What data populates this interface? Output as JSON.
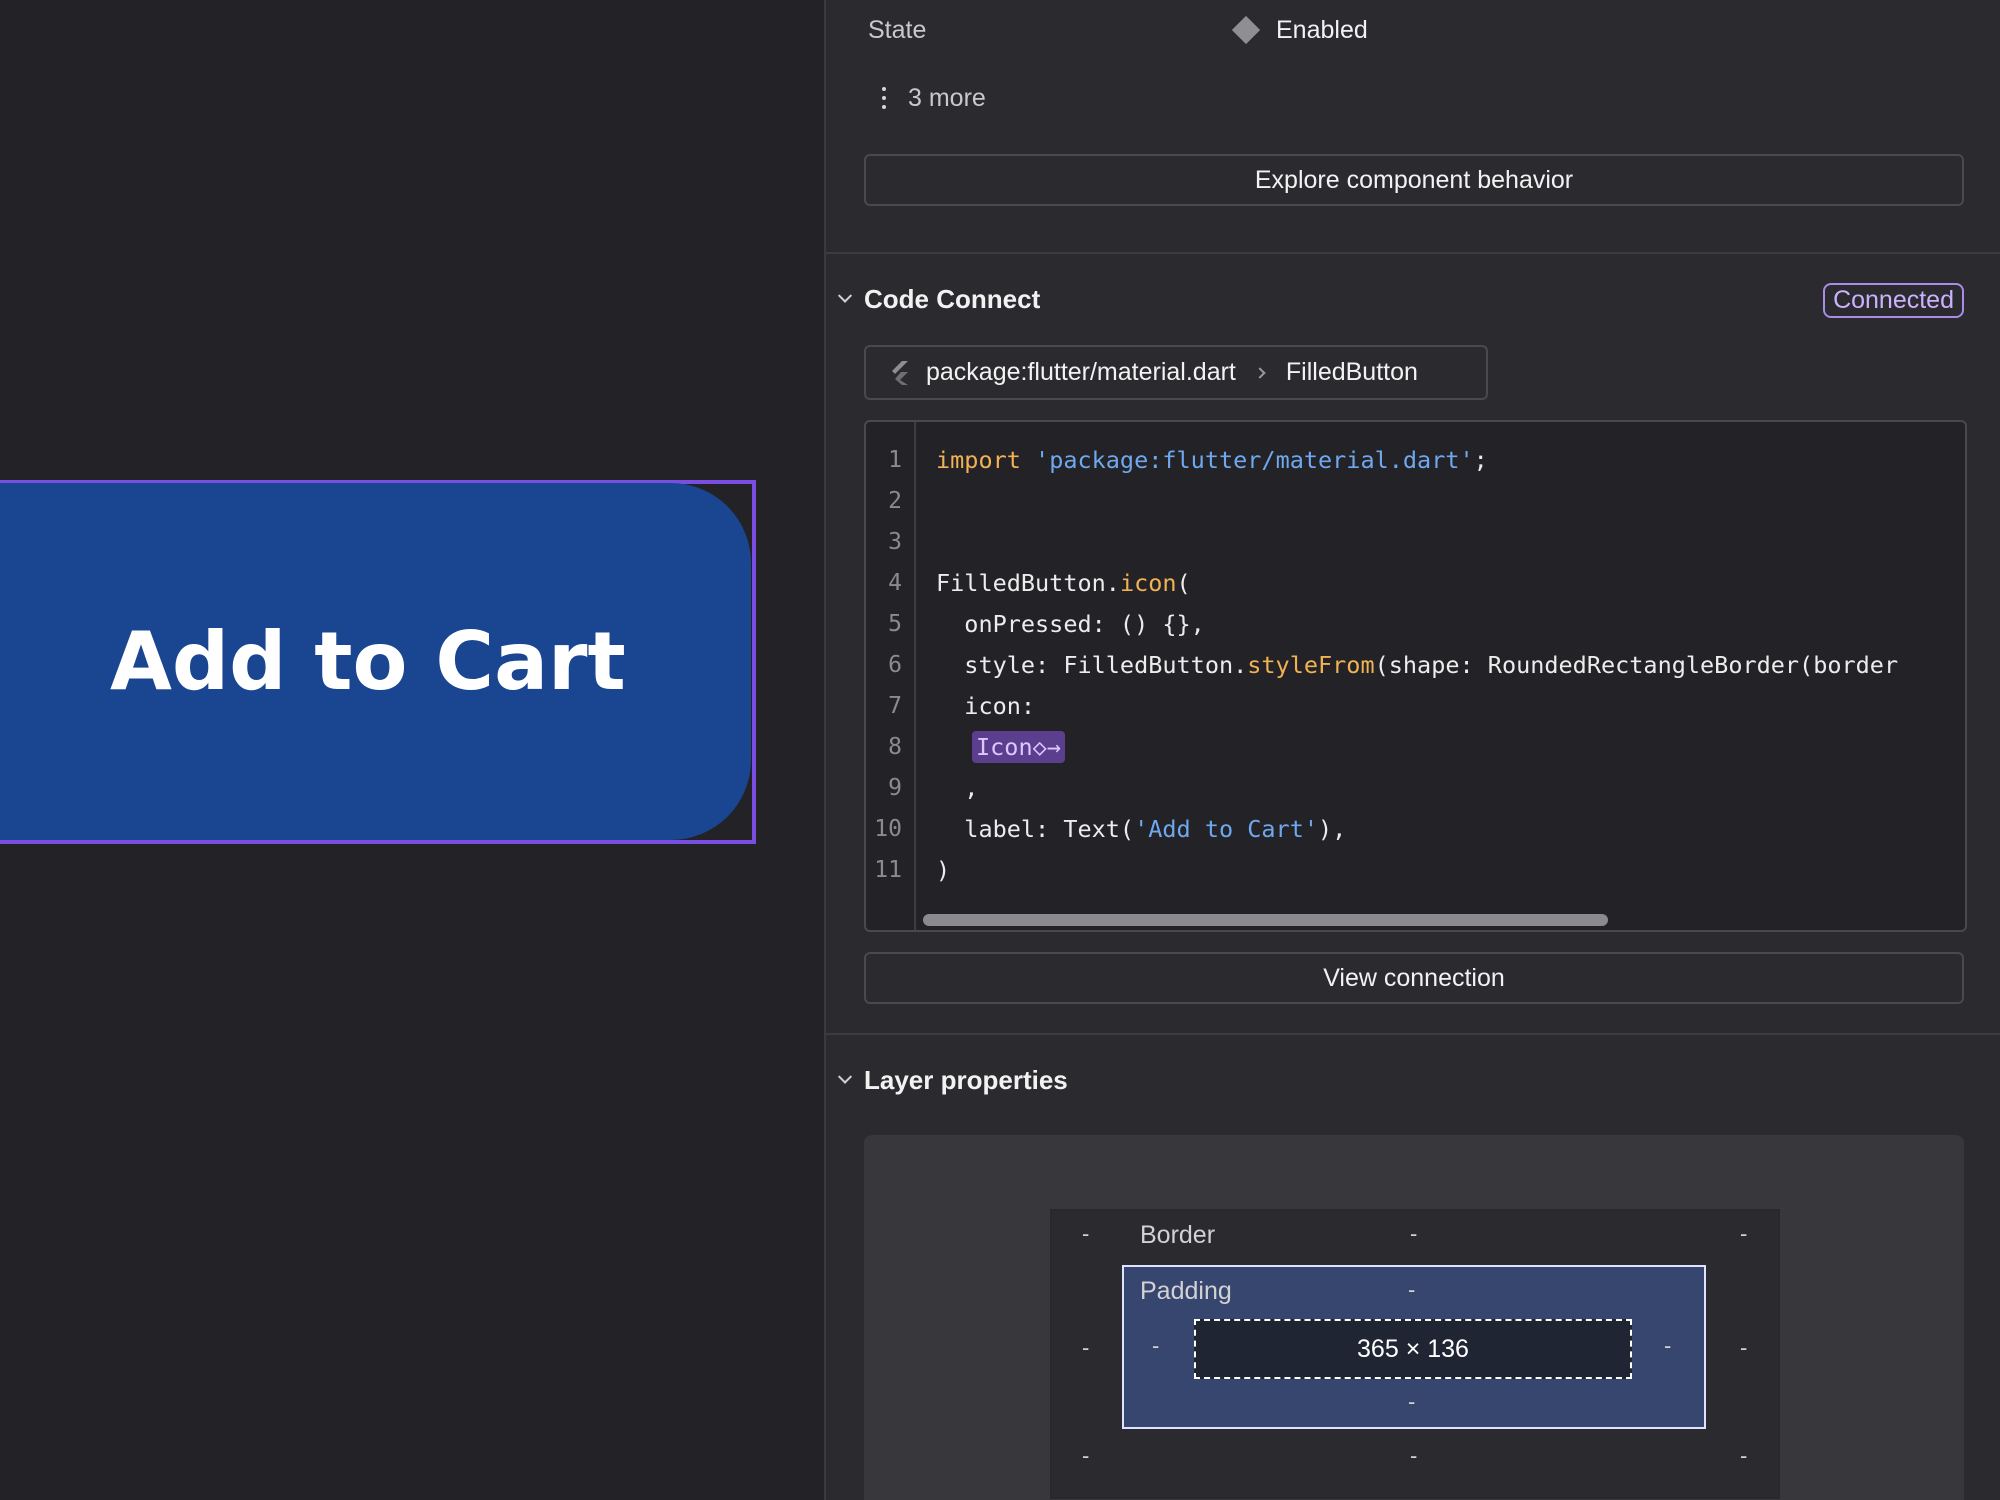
{
  "canvas": {
    "button_label": "Add to Cart",
    "selection_color": "#7a4ee0",
    "button_color": "#1a4590"
  },
  "properties": {
    "state_label": "State",
    "state_value": "Enabled",
    "more_label": "3 more",
    "explore_button": "Explore component behavior"
  },
  "code_connect": {
    "title": "Code Connect",
    "status_badge": "Connected",
    "breadcrumb_package": "package:flutter/material.dart",
    "breadcrumb_component": "FilledButton",
    "line_numbers": [
      "1",
      "2",
      "3",
      "4",
      "5",
      "6",
      "7",
      "8",
      "9",
      "10",
      "11"
    ],
    "code": {
      "l1_kw": "import",
      "l1_str": "'package:flutter/material.dart'",
      "l1_end": ";",
      "l4_a": "FilledButton.",
      "l4_fn": "icon",
      "l4_b": "(",
      "l5": "  onPressed: () {},",
      "l6_a": "  style: FilledButton.",
      "l6_fn": "styleFrom",
      "l6_b": "(shape: RoundedRectangleBorder(border",
      "l7": "  icon:",
      "l8_chip": "Icon◇→",
      "l9": "  ,",
      "l10_a": "  label: Text(",
      "l10_str": "'Add to Cart'",
      "l10_b": "),",
      "l11": ")"
    },
    "view_button": "View connection"
  },
  "layer_properties": {
    "title": "Layer properties",
    "border_label": "Border",
    "padding_label": "Padding",
    "dimensions": "365 × 136",
    "empty_value": "-"
  }
}
